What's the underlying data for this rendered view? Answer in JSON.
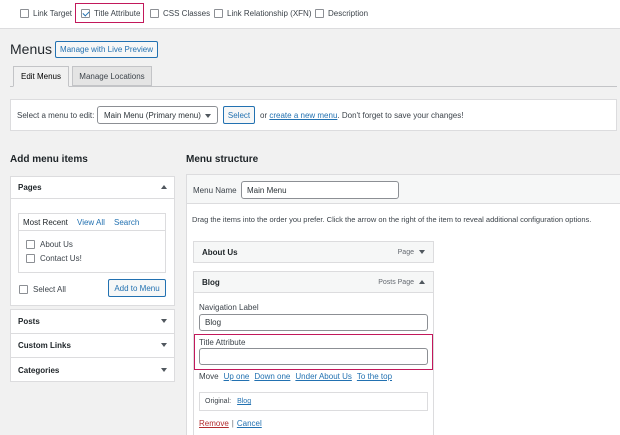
{
  "screen_options": {
    "link_target": "Link Target",
    "title_attribute": "Title Attribute",
    "css_classes": "CSS Classes",
    "link_relationship": "Link Relationship (XFN)",
    "description": "Description"
  },
  "page": {
    "title": "Menus",
    "live_preview_button": "Manage with Live Preview"
  },
  "tabs": {
    "edit_menus": "Edit Menus",
    "manage_locations": "Manage Locations"
  },
  "select_bar": {
    "label": "Select a menu to edit:",
    "selected": "Main Menu (Primary menu)",
    "select_button": "Select",
    "or": "or",
    "create_link": "create a new menu",
    "tail": ". Don't forget to save your changes!"
  },
  "add_items": {
    "heading": "Add menu items",
    "pages_title": "Pages",
    "tabs": {
      "most_recent": "Most Recent",
      "view_all": "View All",
      "search": "Search"
    },
    "pages": [
      "About Us",
      "Contact Us!"
    ],
    "select_all": "Select All",
    "add_button": "Add to Menu",
    "sections": [
      "Posts",
      "Custom Links",
      "Categories"
    ]
  },
  "structure": {
    "heading": "Menu structure",
    "menu_name_label": "Menu Name",
    "menu_name_value": "Main Menu",
    "instructions": "Drag the items into the order you prefer. Click the arrow on the right of the item to reveal additional configuration options.",
    "item1": {
      "title": "About Us",
      "type": "Page"
    },
    "item2": {
      "title": "Blog",
      "type": "Posts Page",
      "nav_label_label": "Navigation Label",
      "nav_label_value": "Blog",
      "title_attr_label": "Title Attribute",
      "title_attr_value": "",
      "move_label": "Move",
      "move_up": "Up one",
      "move_down": "Down one",
      "move_under": "Under About Us",
      "move_top": "To the top",
      "original_label": "Original:",
      "original_link": "Blog",
      "remove": "Remove",
      "separator": "|",
      "cancel": "Cancel"
    }
  },
  "colors": {
    "accent": "#2271b1",
    "highlight": "#c2185b",
    "remove": "#b32d2e"
  }
}
